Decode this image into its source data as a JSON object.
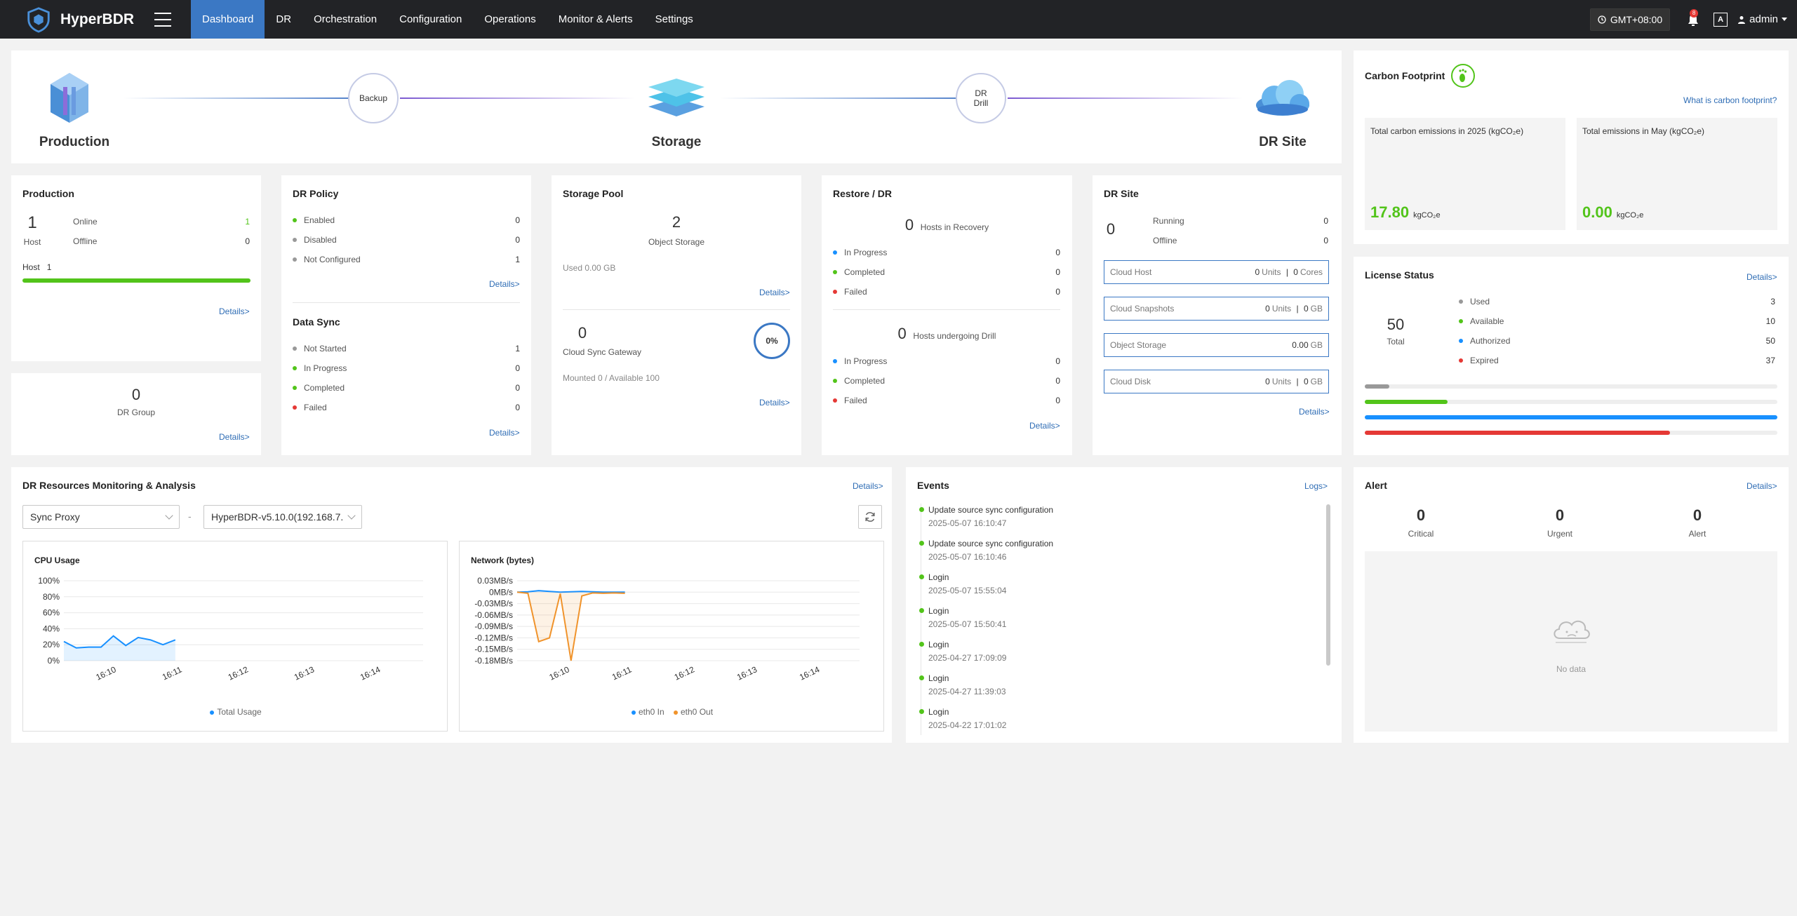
{
  "nav": {
    "brand": "HyperBDR",
    "items": [
      "Dashboard",
      "DR",
      "Orchestration",
      "Configuration",
      "Operations",
      "Monitor & Alerts",
      "Settings"
    ],
    "timezone": "GMT+08:00",
    "notifications": "8",
    "lang": "A",
    "user": "admin"
  },
  "flow": {
    "production": "Production",
    "backup": "Backup",
    "storage": "Storage",
    "drill_line1": "DR",
    "drill_line2": "Drill",
    "dr_site": "DR Site"
  },
  "production": {
    "title": "Production",
    "host_count": "1",
    "host_label": "Host",
    "online_label": "Online",
    "online": "1",
    "offline_label": "Offline",
    "offline": "0",
    "bar_label": "Host",
    "bar_value": "1",
    "bar_fraction": 1.0,
    "details": "Details>"
  },
  "dr_group": {
    "count": "0",
    "label": "DR Group",
    "details": "Details>"
  },
  "dr_policy": {
    "title": "DR Policy",
    "rows": [
      {
        "label": "Enabled",
        "value": "0",
        "color": "#52c41a"
      },
      {
        "label": "Disabled",
        "value": "0",
        "color": "#999999"
      },
      {
        "label": "Not Configured",
        "value": "1",
        "color": "#999999"
      }
    ],
    "details": "Details>"
  },
  "data_sync": {
    "title": "Data Sync",
    "rows": [
      {
        "label": "Not Started",
        "value": "1",
        "color": "#999999"
      },
      {
        "label": "In Progress",
        "value": "0",
        "color": "#52c41a"
      },
      {
        "label": "Completed",
        "value": "0",
        "color": "#52c41a"
      },
      {
        "label": "Failed",
        "value": "0",
        "color": "#e53935"
      }
    ],
    "details": "Details>"
  },
  "storage_pool": {
    "title": "Storage Pool",
    "count": "2",
    "count_label": "Object Storage",
    "used": "Used 0.00 GB",
    "details": "Details>",
    "gateway_count": "0",
    "gateway_label": "Cloud Sync Gateway",
    "gateway_percent": "0%",
    "mounted": "Mounted 0 / Available 100",
    "details2": "Details>"
  },
  "restore": {
    "title": "Restore / DR",
    "recovery_count": "0",
    "recovery_label": "Hosts in Recovery",
    "recovery_rows": [
      {
        "label": "In Progress",
        "value": "0",
        "color": "#1890ff"
      },
      {
        "label": "Completed",
        "value": "0",
        "color": "#52c41a"
      },
      {
        "label": "Failed",
        "value": "0",
        "color": "#e53935"
      }
    ],
    "drill_count": "0",
    "drill_label": "Hosts undergoing Drill",
    "drill_rows": [
      {
        "label": "In Progress",
        "value": "0",
        "color": "#1890ff"
      },
      {
        "label": "Completed",
        "value": "0",
        "color": "#52c41a"
      },
      {
        "label": "Failed",
        "value": "0",
        "color": "#e53935"
      }
    ],
    "details": "Details>"
  },
  "dr_site": {
    "title": "DR Site",
    "count": "0",
    "running_label": "Running",
    "running": "0",
    "offline_label": "Offline",
    "offline": "0",
    "boxes": [
      {
        "label": "Cloud Host",
        "v1": "0",
        "u1": "Units",
        "v2": "0",
        "u2": "Cores"
      },
      {
        "label": "Cloud Snapshots",
        "v1": "0",
        "u1": "Units",
        "v2": "0",
        "u2": "GB"
      },
      {
        "label": "Object Storage",
        "v1": "",
        "u1": "",
        "v2": "0.00",
        "u2": "GB"
      },
      {
        "label": "Cloud Disk",
        "v1": "0",
        "u1": "Units",
        "v2": "0",
        "u2": "GB"
      }
    ],
    "details": "Details>"
  },
  "carbon": {
    "title": "Carbon Footprint",
    "link": "What is carbon footprint?",
    "year_label": "Total carbon emissions in 2025 (kgCO₂e)",
    "year_value": "17.80",
    "month_label": "Total emissions in May (kgCO₂e)",
    "month_value": "0.00",
    "unit": "kgCO₂e",
    "accent": "#52c41a"
  },
  "license": {
    "title": "License Status",
    "details": "Details>",
    "total": "50",
    "total_label": "Total",
    "rows": [
      {
        "label": "Used",
        "value": "3",
        "color": "#999999",
        "fraction": 0.06
      },
      {
        "label": "Available",
        "value": "10",
        "color": "#52c41a",
        "fraction": 0.2
      },
      {
        "label": "Authorized",
        "value": "50",
        "color": "#1890ff",
        "fraction": 1.0
      },
      {
        "label": "Expired",
        "value": "37",
        "color": "#e53935",
        "fraction": 0.74
      }
    ]
  },
  "monitor": {
    "title": "DR Resources Monitoring & Analysis",
    "details": "Details>",
    "select1": "Sync Proxy",
    "separator": "-",
    "select2": "HyperBDR-v5.10.0(192.168.7."
  },
  "chart_data": [
    {
      "type": "area",
      "title": "CPU Usage",
      "categories": [
        "16:10",
        "16:11",
        "16:12",
        "16:13",
        "16:14"
      ],
      "yticks": [
        "100%",
        "80%",
        "60%",
        "40%",
        "20%",
        "0%"
      ],
      "ylim": [
        0,
        100
      ],
      "series": [
        {
          "name": "Total Usage",
          "color": "#1890ff",
          "x": [
            0,
            0.1,
            0.2,
            0.3,
            0.4,
            0.5,
            0.6,
            0.7,
            0.8,
            0.9,
            1.0,
            1.1,
            1.2
          ],
          "values": [
            24,
            16,
            17,
            17,
            31,
            19,
            29,
            26,
            20,
            26,
            null,
            null,
            null
          ]
        }
      ]
    },
    {
      "type": "area",
      "title": "Network (bytes)",
      "categories": [
        "16:10",
        "16:11",
        "16:12",
        "16:13",
        "16:14"
      ],
      "yticks": [
        "0.03MB/s",
        "0MB/s",
        "-0.03MB/s",
        "-0.06MB/s",
        "-0.09MB/s",
        "-0.12MB/s",
        "-0.15MB/s",
        "-0.18MB/s"
      ],
      "ylim": [
        -0.18,
        0.03
      ],
      "series": [
        {
          "name": "eth0 In",
          "color": "#1890ff",
          "values": [
            0,
            0.001,
            0.004,
            0.002,
            0.0,
            0.001,
            0.002,
            0.001,
            0.0,
            0.0,
            0.0
          ]
        },
        {
          "name": "eth0 Out",
          "color": "#f0932b",
          "values": [
            0,
            -0.003,
            -0.13,
            -0.12,
            -0.004,
            -0.18,
            -0.01,
            -0.002,
            -0.003,
            -0.002,
            -0.003
          ]
        }
      ]
    }
  ],
  "events": {
    "title": "Events",
    "logs": "Logs>",
    "items": [
      {
        "title": "Update source sync configuration",
        "time": "2025-05-07 16:10:47"
      },
      {
        "title": "Update source sync configuration",
        "time": "2025-05-07 16:10:46"
      },
      {
        "title": "Login",
        "time": "2025-05-07 15:55:04"
      },
      {
        "title": "Login",
        "time": "2025-05-07 15:50:41"
      },
      {
        "title": "Login",
        "time": "2025-04-27 17:09:09"
      },
      {
        "title": "Login",
        "time": "2025-04-27 11:39:03"
      },
      {
        "title": "Login",
        "time": "2025-04-22 17:01:02"
      }
    ]
  },
  "alert": {
    "title": "Alert",
    "details": "Details>",
    "critical": "0",
    "critical_label": "Critical",
    "urgent": "0",
    "urgent_label": "Urgent",
    "alert": "0",
    "alert_label": "Alert",
    "nodata": "No data"
  }
}
